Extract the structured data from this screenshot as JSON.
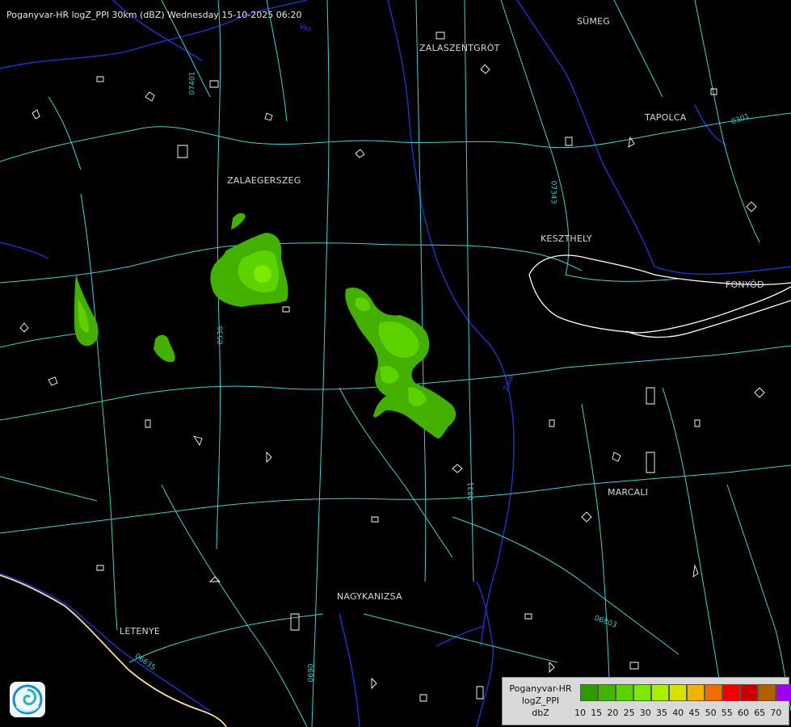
{
  "title": "Poganyvar-HR logZ_PPI 30km (dBZ) Wednesday 15-10-2025 06:20",
  "cities": [
    {
      "id": "sumeg",
      "name": "SÜMEG"
    },
    {
      "id": "zalaszentgrot",
      "name": "ZALASZENTGRÓT"
    },
    {
      "id": "tapolca",
      "name": "TAPOLCA"
    },
    {
      "id": "zalaegerszeg",
      "name": "ZALAEGERSZEG"
    },
    {
      "id": "keszthely",
      "name": "KESZTHELY"
    },
    {
      "id": "fonyod",
      "name": "FONYÓD"
    },
    {
      "id": "marcali",
      "name": "MARCALI"
    },
    {
      "id": "nagykanizsa",
      "name": "NAGYKANIZSA"
    },
    {
      "id": "letenye",
      "name": "LETENYE"
    }
  ],
  "roads": [
    {
      "id": "r07401",
      "name": "07401"
    },
    {
      "id": "r07343",
      "name": "07343"
    },
    {
      "id": "r0536",
      "name": "0536"
    },
    {
      "id": "r0831",
      "name": "0831"
    },
    {
      "id": "r06803",
      "name": "06803"
    },
    {
      "id": "r06635",
      "name": "06635"
    },
    {
      "id": "r0301",
      "name": "0301"
    },
    {
      "id": "r0690",
      "name": "0690"
    }
  ],
  "rivers": [
    {
      "id": "zala",
      "name": "Zala"
    },
    {
      "id": "vas",
      "name": "Vas"
    }
  ],
  "legend": {
    "line1": "Poganyvar-HR",
    "line2": "logZ_PPI",
    "line3": "dbZ",
    "ticks": [
      "10",
      "15",
      "20",
      "25",
      "30",
      "35",
      "40",
      "45",
      "50",
      "55",
      "60",
      "65",
      "70"
    ],
    "colors": [
      "#2e9a00",
      "#45b400",
      "#5cd200",
      "#7de800",
      "#a8f000",
      "#d8e000",
      "#f0b400",
      "#f06e00",
      "#f00000",
      "#c80000",
      "#b06000",
      "#a000f0",
      "#b4b4ff"
    ]
  }
}
